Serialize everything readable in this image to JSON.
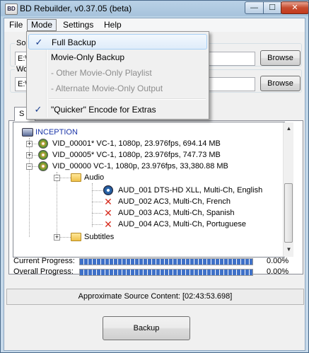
{
  "window": {
    "title": "BD Rebuilder, v0.37.05 (beta)",
    "app_icon_text": "BD",
    "min_glyph": "—",
    "max_glyph": "☐",
    "close_glyph": "✕"
  },
  "menubar": {
    "items": [
      "File",
      "Mode",
      "Settings",
      "Help"
    ]
  },
  "mode_menu": {
    "items": [
      {
        "label": "Full Backup",
        "checked": true,
        "enabled": true
      },
      {
        "label": "Movie-Only Backup",
        "checked": false,
        "enabled": true
      },
      {
        "label": "- Other Movie-Only Playlist",
        "checked": false,
        "enabled": false
      },
      {
        "label": "- Alternate Movie-Only Output",
        "checked": false,
        "enabled": false
      },
      {
        "label": "\"Quicker\" Encode for Extras",
        "checked": true,
        "enabled": true
      }
    ],
    "check_glyph": "✓"
  },
  "source": {
    "group_label": "So",
    "path": "E:\\",
    "browse_label": "Browse"
  },
  "work": {
    "group_label": "Wo",
    "path": "E:\\",
    "browse_label": "Browse"
  },
  "tab": {
    "label": "S"
  },
  "tree": {
    "root_label": "INCEPTION",
    "videos": [
      {
        "label": "VID_00001* VC-1, 1080p, 23.976fps, 694.14 MB",
        "expanded": false
      },
      {
        "label": "VID_00005* VC-1, 1080p, 23.976fps, 747.73 MB",
        "expanded": false
      },
      {
        "label": "VID_00000  VC-1, 1080p, 23.976fps, 33,380.88 MB",
        "expanded": true
      }
    ],
    "audio_folder": "Audio",
    "audio_tracks": [
      {
        "label": "AUD_001 DTS-HD XLL, Multi-Ch, English",
        "kept": true
      },
      {
        "label": "AUD_002 AC3, Multi-Ch, French",
        "kept": false
      },
      {
        "label": "AUD_003 AC3, Multi-Ch, Spanish",
        "kept": false
      },
      {
        "label": "AUD_004 AC3, Multi-Ch, Portuguese",
        "kept": false
      }
    ],
    "subtitles_folder": "Subtitles",
    "expand_glyph": "+",
    "collapse_glyph": "−",
    "excluded_glyph": "✕"
  },
  "progress": {
    "current_label": "Current Progress:",
    "current_value": "0.00%",
    "overall_label": "Overall Progress:",
    "overall_value": "0.00%"
  },
  "status": {
    "text": "Approximate Source Content: [02:43:53.698]"
  },
  "actions": {
    "backup_label": "Backup"
  },
  "scrollbar": {
    "up_glyph": "▲",
    "down_glyph": "▼"
  }
}
